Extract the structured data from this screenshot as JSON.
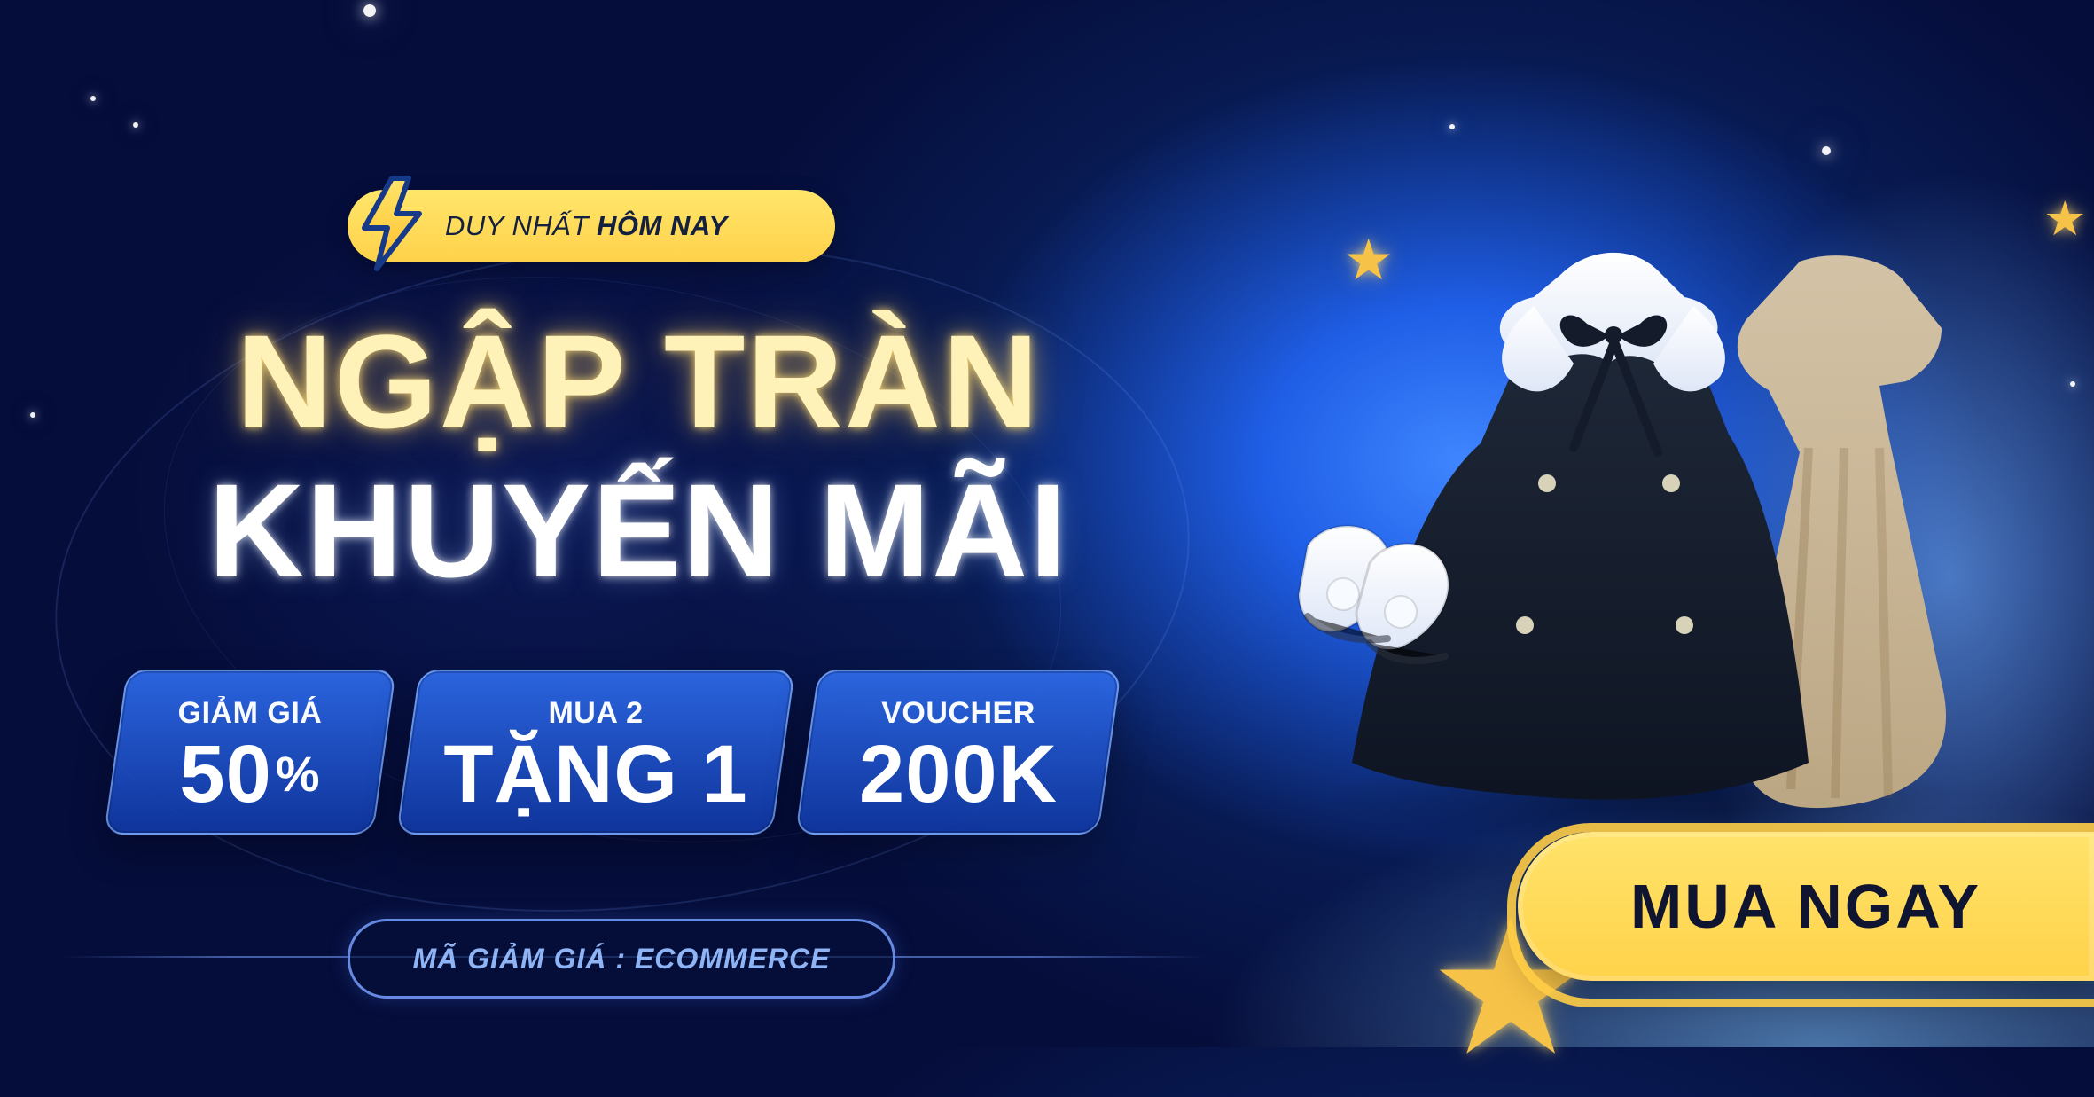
{
  "tag": {
    "normal": "DUY NHẤT",
    "bold": "HÔM NAY",
    "icon": "lightning-bolt"
  },
  "headline": {
    "line1": "NGẬP TRÀN",
    "line2": "KHUYẾN MÃI"
  },
  "offers": [
    {
      "top": "GIẢM GIÁ",
      "bottom": "50",
      "suffix": "%"
    },
    {
      "top": "MUA 2",
      "bottom": "TẶNG 1",
      "suffix": ""
    },
    {
      "top": "VOUCHER",
      "bottom": "200K",
      "suffix": ""
    }
  ],
  "coupon": {
    "label": "MÃ GIẢM GIÁ : ECOMMERCE"
  },
  "cta": {
    "label": "MUA NGAY"
  },
  "colors": {
    "bg_dark": "#050d3a",
    "bg_blue": "#1f5ee6",
    "accent_yellow": "#ffd24a",
    "headline_yellow": "#fff2b8",
    "card_blue": "#2d69e6"
  },
  "decorations": {
    "product_icon": "clothing-product-illustration"
  }
}
